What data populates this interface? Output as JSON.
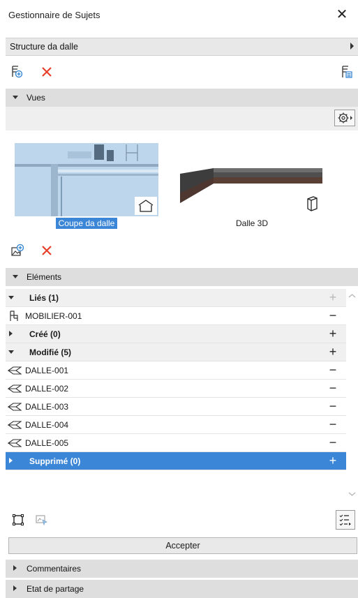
{
  "window": {
    "title": "Gestionnaire de Sujets"
  },
  "subject": {
    "name": "Structure da dalle"
  },
  "sections": {
    "views": "Vues",
    "elements": "Eléments",
    "comments": "Commentaires",
    "sharing": "Etat de partage"
  },
  "views": [
    {
      "caption": "Coupe da dalle",
      "selected": true,
      "type_icon": "section-icon"
    },
    {
      "caption": "Dalle 3D",
      "selected": false,
      "type_icon": "3d-box-icon"
    }
  ],
  "elements": {
    "linked": {
      "label": "Liés (1)",
      "items": [
        "MOBILIER-001"
      ]
    },
    "created": {
      "label": "Créé (0)"
    },
    "modified": {
      "label": "Modifié (5)",
      "items": [
        "DALLE-001",
        "DALLE-002",
        "DALLE-003",
        "DALLE-004",
        "DALLE-005"
      ]
    },
    "deleted": {
      "label": "Supprimé (0)"
    }
  },
  "buttons": {
    "accept": "Accepter"
  },
  "colors": {
    "accent": "#3b86d6",
    "delete": "#e8402b",
    "add_icon": "#2a7fcf"
  }
}
